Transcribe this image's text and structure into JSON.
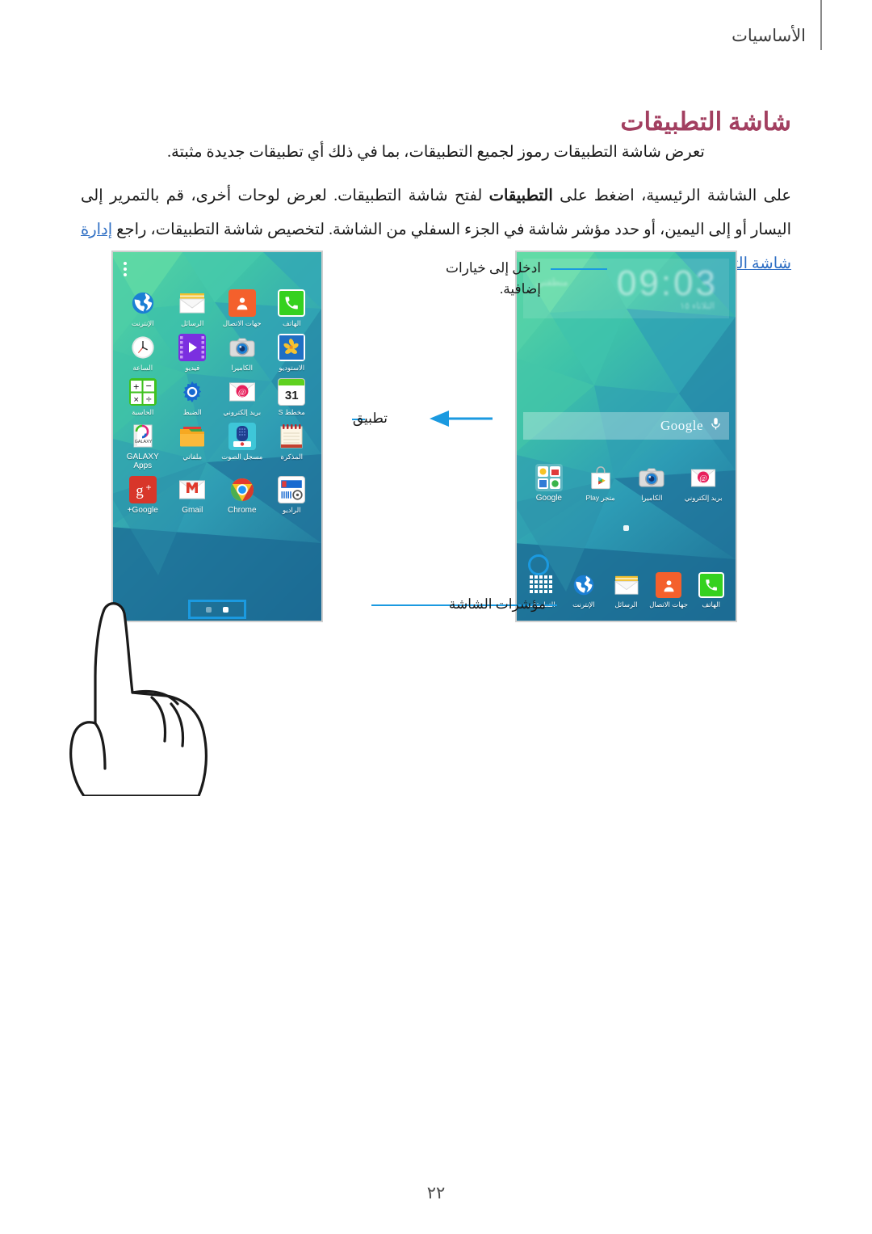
{
  "header": {
    "section_label": "الأساسيات"
  },
  "title": "شاشة التطبيقات",
  "paragraphs": {
    "p1": "تعرض شاشة التطبيقات رموز لجميع التطبيقات، بما في ذلك أي تطبيقات جديدة مثبتة.",
    "p2_a": "على الشاشة الرئيسية، اضغط على ",
    "p2_bold": "التطبيقات",
    "p2_b": " لفتح شاشة التطبيقات. لعرض لوحات أخرى، قم بالتمرير إلى اليسار أو إلى اليمين، أو حدد مؤشر شاشة في الجزء السفلي من الشاشة. لتخصيص شاشة التطبيقات، راجع ",
    "p2_link": "إدارة شاشة التطبيقات",
    "p2_c": "."
  },
  "callouts": {
    "more_options": "ادخل إلى خيارات\nإضافية.",
    "application": "تطبيق",
    "screen_indicators": "مؤشرات الشاشة"
  },
  "apps_screen": {
    "overflow_icon": "more-options-icon",
    "rows": [
      [
        {
          "id": "phone",
          "label": "الهاتف",
          "icon": "phone-icon"
        },
        {
          "id": "contacts",
          "label": "جهات الاتصال",
          "icon": "contacts-icon"
        },
        {
          "id": "messages",
          "label": "الرسائل",
          "icon": "messages-icon"
        },
        {
          "id": "internet",
          "label": "الإنترنت",
          "icon": "internet-icon"
        }
      ],
      [
        {
          "id": "gallery",
          "label": "الاستوديو",
          "icon": "gallery-icon"
        },
        {
          "id": "camera",
          "label": "الكاميرا",
          "icon": "camera-icon"
        },
        {
          "id": "video",
          "label": "فيديو",
          "icon": "video-icon"
        },
        {
          "id": "clock",
          "label": "الساعة",
          "icon": "clock-icon"
        }
      ],
      [
        {
          "id": "splanner",
          "label": "مخطط S",
          "icon": "calendar-icon",
          "badge": "31"
        },
        {
          "id": "email",
          "label": "بريد إلكتروني",
          "icon": "email-icon"
        },
        {
          "id": "settings",
          "label": "الضبط",
          "icon": "settings-gear-icon"
        },
        {
          "id": "calculator",
          "label": "الحاسبة",
          "icon": "calculator-icon"
        }
      ],
      [
        {
          "id": "memo",
          "label": "المذكرة",
          "icon": "memo-icon"
        },
        {
          "id": "voicerec",
          "label": "مسجل الصوت",
          "icon": "voice-recorder-icon"
        },
        {
          "id": "myfiles",
          "label": "ملفاتي",
          "icon": "folder-icon"
        },
        {
          "id": "galaxyapps",
          "label": "GALAXY Apps",
          "icon": "galaxy-apps-icon",
          "latin": true
        }
      ],
      [
        {
          "id": "radio",
          "label": "الراديو",
          "icon": "radio-icon"
        },
        {
          "id": "chrome",
          "label": "Chrome",
          "icon": "chrome-icon",
          "latin": true
        },
        {
          "id": "gmail",
          "label": "Gmail",
          "icon": "gmail-icon",
          "latin": true
        },
        {
          "id": "googleplus",
          "label": "Google+",
          "icon": "google-plus-icon",
          "latin": true
        }
      ]
    ],
    "page_dots": {
      "total": 2,
      "active_index": 0
    }
  },
  "home_screen": {
    "clock_widget": {
      "time": "09:03",
      "subtitle": "الثلاثاء ١٥",
      "weather": "منطقتي"
    },
    "search_bar": {
      "label": "Google",
      "mic_icon": "microphone-icon"
    },
    "apps_row": [
      {
        "id": "email",
        "label": "بريد إلكتروني",
        "icon": "email-icon"
      },
      {
        "id": "camera",
        "label": "الكاميرا",
        "icon": "camera-icon"
      },
      {
        "id": "playstore",
        "label": "متجر Play",
        "icon": "play-store-icon"
      },
      {
        "id": "google",
        "label": "Google",
        "icon": "google-folder-icon",
        "latin": true
      }
    ],
    "dock": [
      {
        "id": "phone",
        "label": "الهاتف",
        "icon": "phone-icon"
      },
      {
        "id": "contacts",
        "label": "جهات الاتصال",
        "icon": "contacts-icon"
      },
      {
        "id": "messages",
        "label": "الرسائل",
        "icon": "messages-icon"
      },
      {
        "id": "internet",
        "label": "الإنترنت",
        "icon": "internet-icon"
      },
      {
        "id": "apps",
        "label": "التطبيقات",
        "icon": "apps-grid-icon"
      }
    ],
    "page_dots": {
      "total": 1,
      "active_index": 0
    }
  },
  "page_number": "٢٢",
  "colors": {
    "title": "#a23f60",
    "link": "#2f6fc4",
    "callout": "#1b9ae0",
    "highlight": "#1b9ae0"
  }
}
